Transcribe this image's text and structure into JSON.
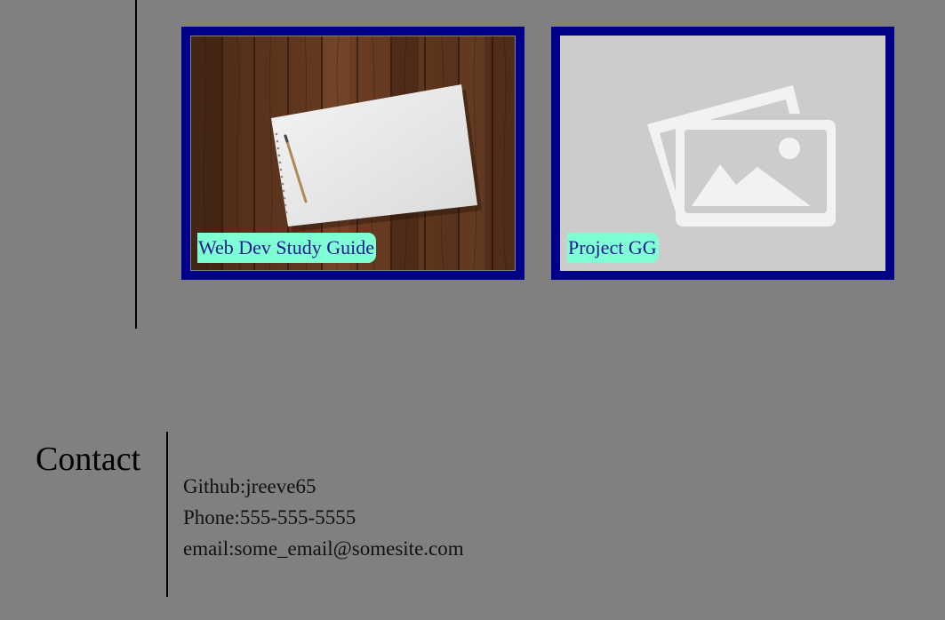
{
  "projects": [
    {
      "title": "Web Dev Study Guide",
      "image": "notebook-on-wood-photo"
    },
    {
      "title": "Project GG",
      "image": "image-placeholder-icon"
    }
  ],
  "contact": {
    "heading": "Contact",
    "github": "Github:jreeve65",
    "phone": "Phone:555-555-5555",
    "email": "email:some_email@somesite.com"
  },
  "colors": {
    "background": "#808080",
    "card_border": "#00008b",
    "label_bg": "#7fffd4",
    "label_text": "#1b1b8f",
    "placeholder_bg": "#cccccc",
    "placeholder_icon": "#f2f2f2"
  }
}
